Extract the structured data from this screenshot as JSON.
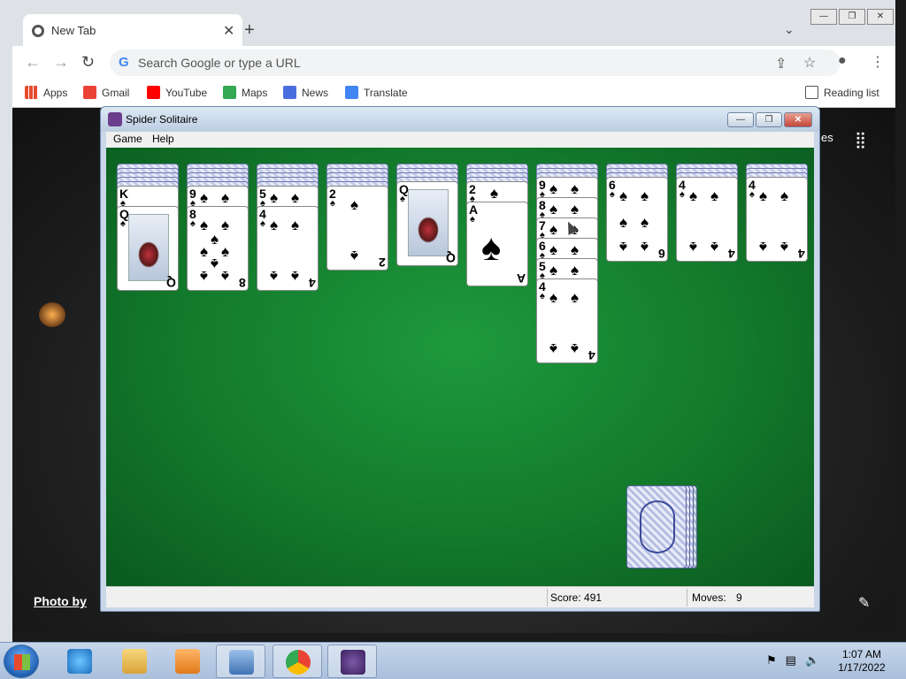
{
  "browser": {
    "tab_title": "New Tab",
    "omnibox_placeholder": "Search Google or type a URL",
    "bookmarks": [
      {
        "label": "Apps",
        "color": "#4285f4"
      },
      {
        "label": "Gmail",
        "color": "#ea4335"
      },
      {
        "label": "YouTube",
        "color": "#ff0000"
      },
      {
        "label": "Maps",
        "color": "#34a853"
      },
      {
        "label": "News",
        "color": "#4a6ee0"
      },
      {
        "label": "Translate",
        "color": "#4285f4"
      }
    ],
    "reading_list": "Reading list"
  },
  "ntp": {
    "partial_text": "es",
    "photo_credit": "Photo by"
  },
  "solitaire": {
    "title": "Spider Solitaire",
    "menus": [
      "Game",
      "Help"
    ],
    "score_label": "Score: 491",
    "moves_label": "Moves:",
    "moves_value": "9",
    "columns": [
      {
        "face_down": 5,
        "cards": [
          {
            "rank": "K",
            "suit": "♠",
            "face": true
          },
          {
            "rank": "Q",
            "suit": "♠",
            "face": true
          }
        ]
      },
      {
        "face_down": 5,
        "cards": [
          {
            "rank": "9",
            "suit": "♠"
          },
          {
            "rank": "8",
            "suit": "♠"
          }
        ]
      },
      {
        "face_down": 5,
        "cards": [
          {
            "rank": "5",
            "suit": "♠"
          },
          {
            "rank": "4",
            "suit": "♠"
          }
        ]
      },
      {
        "face_down": 5,
        "cards": [
          {
            "rank": "2",
            "suit": "♠"
          }
        ]
      },
      {
        "face_down": 4,
        "cards": [
          {
            "rank": "Q",
            "suit": "♠",
            "face": true
          }
        ]
      },
      {
        "face_down": 4,
        "cards": [
          {
            "rank": "2",
            "suit": "♠"
          },
          {
            "rank": "A",
            "suit": "♠"
          }
        ]
      },
      {
        "face_down": 3,
        "cards": [
          {
            "rank": "9",
            "suit": "♠"
          },
          {
            "rank": "8",
            "suit": "♠"
          },
          {
            "rank": "7",
            "suit": "♠"
          },
          {
            "rank": "6",
            "suit": "♠"
          },
          {
            "rank": "5",
            "suit": "♠"
          },
          {
            "rank": "4",
            "suit": "♠"
          }
        ]
      },
      {
        "face_down": 3,
        "cards": [
          {
            "rank": "6",
            "suit": "♠"
          }
        ]
      },
      {
        "face_down": 3,
        "cards": [
          {
            "rank": "4",
            "suit": "♠"
          }
        ]
      },
      {
        "face_down": 3,
        "cards": [
          {
            "rank": "4",
            "suit": "♠"
          }
        ]
      }
    ]
  },
  "taskbar": {
    "time": "1:07 AM",
    "date": "1/17/2022"
  }
}
